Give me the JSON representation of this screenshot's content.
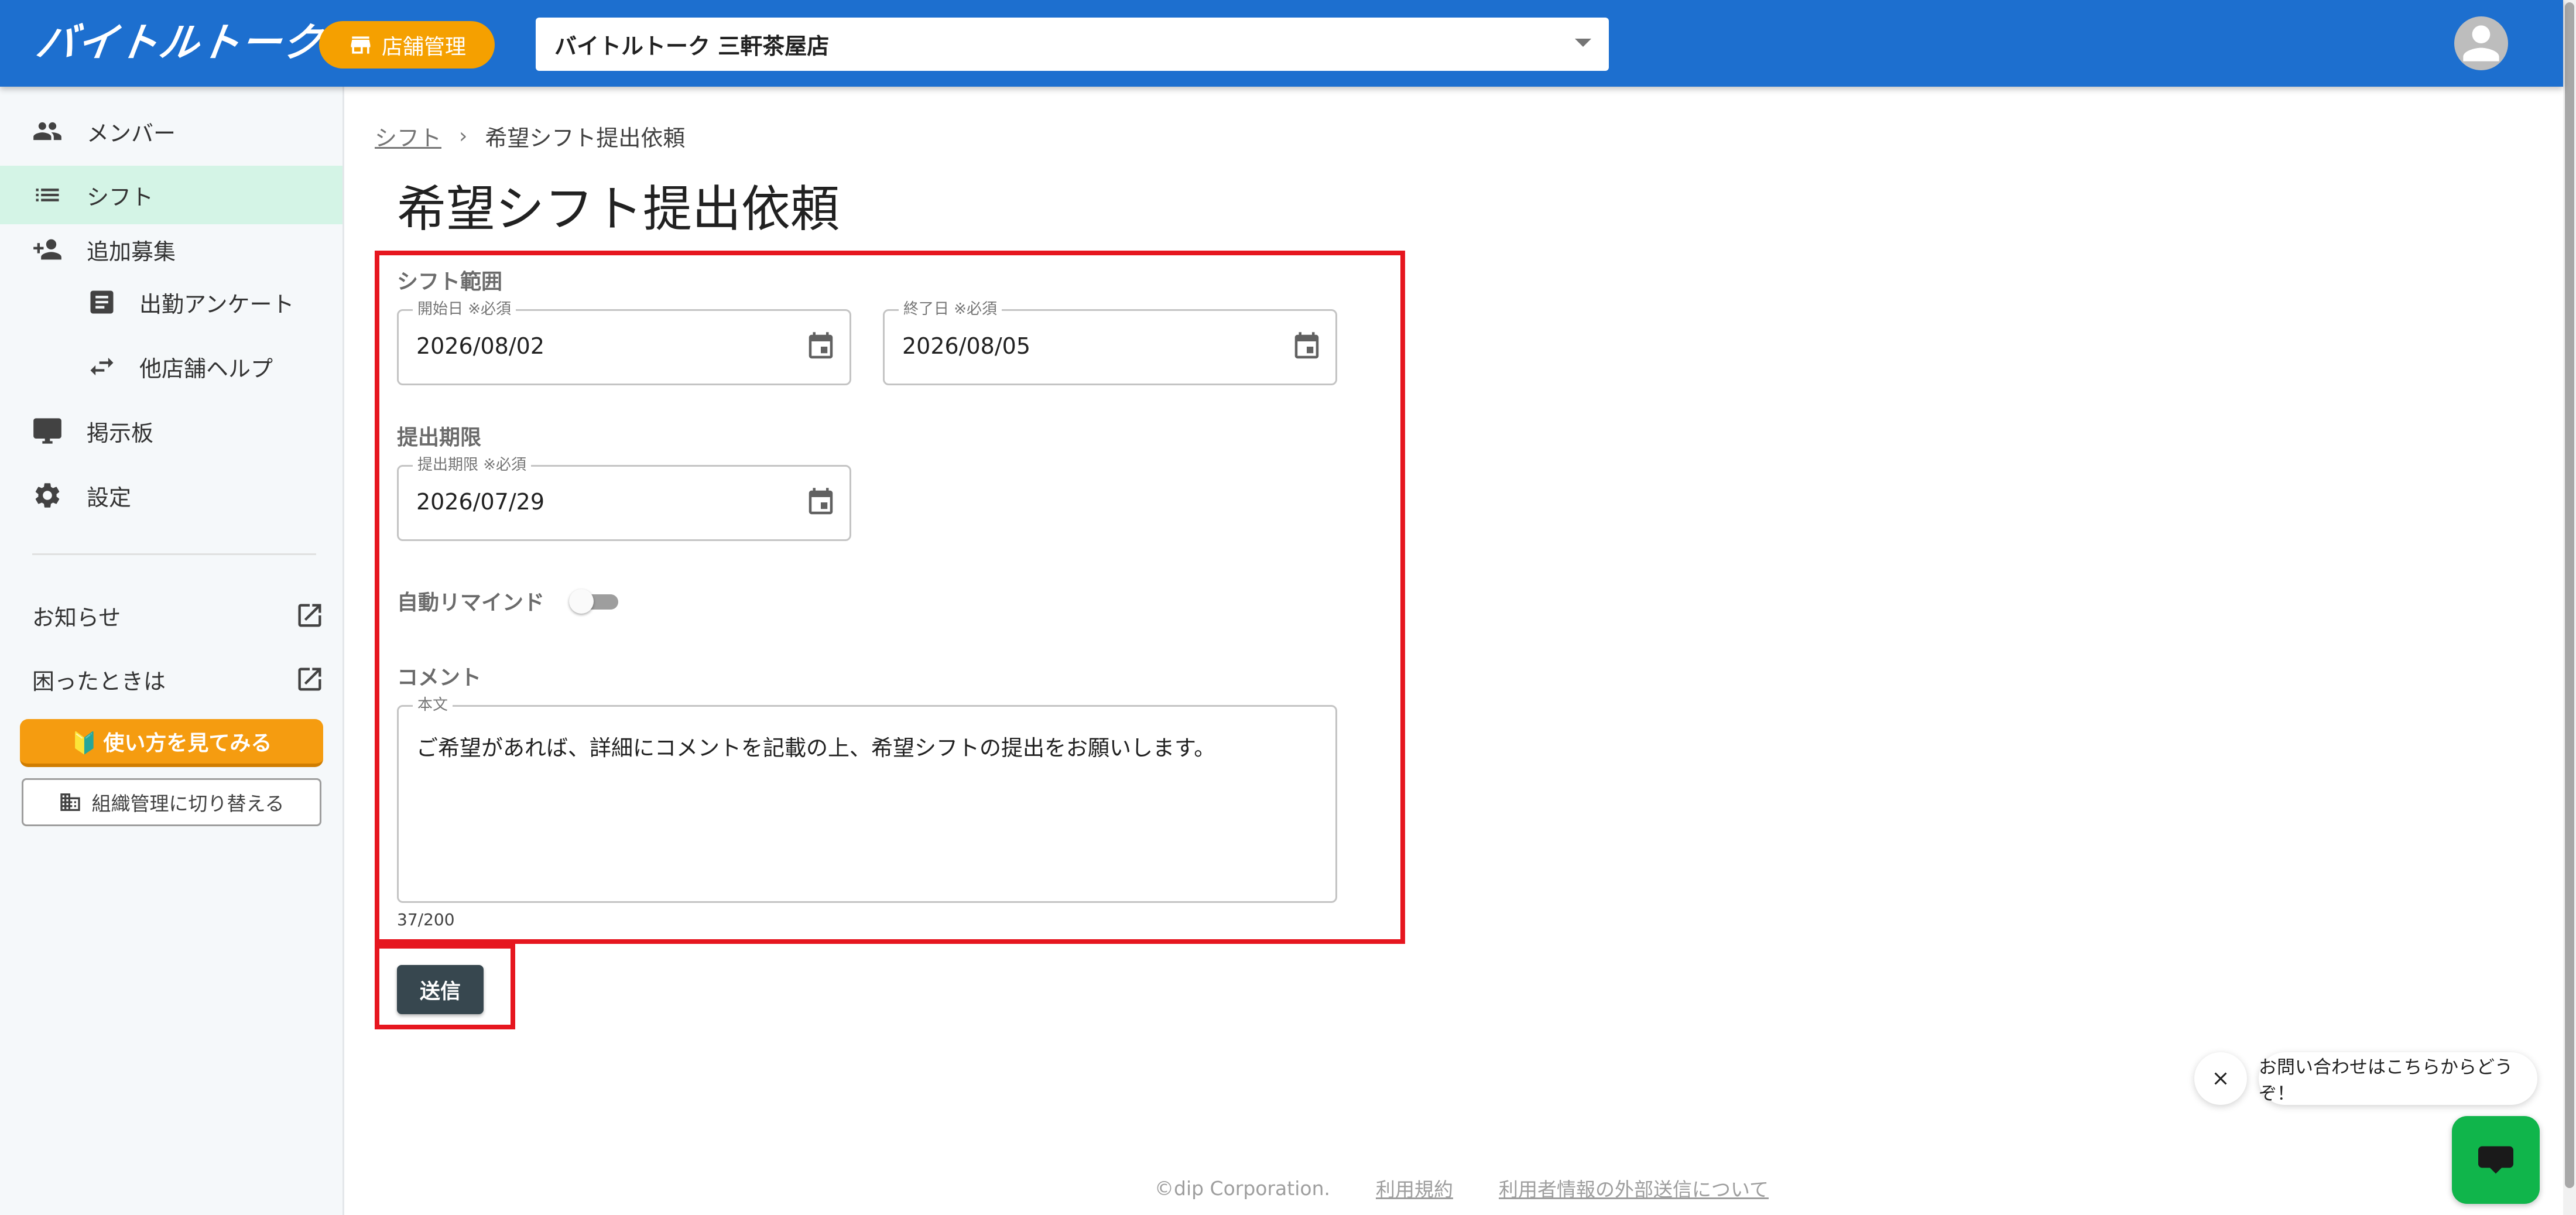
{
  "header": {
    "logo_text": "バイトルトーク",
    "store_mgmt_label": "店舗管理",
    "store_select_value": "バイトルトーク 三軒茶屋店"
  },
  "sidebar": {
    "items": [
      {
        "label": "メンバー",
        "icon": "people-icon"
      },
      {
        "label": "シフト",
        "icon": "list-icon",
        "active": true
      },
      {
        "label": "追加募集",
        "icon": "person-add-icon"
      },
      {
        "label": "出勤アンケート",
        "icon": "form-icon"
      },
      {
        "label": "他店舗ヘルプ",
        "icon": "swap-icon"
      },
      {
        "label": "掲示板",
        "icon": "monitor-icon"
      },
      {
        "label": "設定",
        "icon": "gear-icon"
      }
    ],
    "links": [
      {
        "label": "お知らせ",
        "icon": "external-link-icon"
      },
      {
        "label": "困ったときは",
        "icon": "external-link-icon"
      }
    ],
    "howto_label": "🔰 使い方を見てみる",
    "switch_label": "組織管理に切り替える"
  },
  "breadcrumb": {
    "parent": "シフト",
    "separator": "›",
    "current": "希望シフト提出依頼"
  },
  "page_title": "希望シフト提出依頼",
  "form": {
    "shift_range_label": "シフト範囲",
    "start_label": "開始日 ※必須",
    "start_value": "2026/08/02",
    "end_label": "終了日 ※必須",
    "end_value": "2026/08/05",
    "deadline_section_label": "提出期限",
    "deadline_label": "提出期限 ※必須",
    "deadline_value": "2026/07/29",
    "auto_remind_label": "自動リマインド",
    "auto_remind_on": false,
    "comment_section_label": "コメント",
    "body_label": "本文",
    "body_value": "ご希望があれば、詳細にコメントを記載の上、希望シフトの提出をお願いします。",
    "char_count": "37/200",
    "submit_label": "送信"
  },
  "chat": {
    "bubble_text": "お問い合わせはこちらからどうぞ！"
  },
  "footer": {
    "copyright": "©dip Corporation.",
    "terms": "利用規約",
    "external_info": "利用者情報の外部送信について"
  },
  "colors": {
    "header_bg": "#1d6fcf",
    "accent_orange": "#f5a000",
    "active_nav_bg": "#d4f4e6",
    "highlight_red": "#e6161f",
    "submit_bg": "#37474f",
    "chat_green": "#10b54b"
  }
}
